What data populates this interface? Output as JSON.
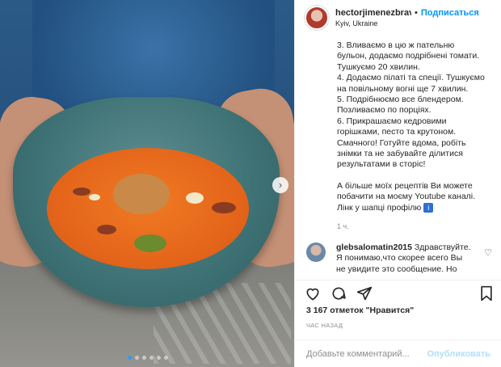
{
  "header": {
    "username": "hectorjimenezbrav",
    "separator": "•",
    "follow_label": "Подписаться",
    "location": "Kyiv, Ukraine"
  },
  "caption": {
    "part1": "3. Вливаємо в цю ж пательню\nбульон, додаємо подрібнені томати.\nТушкуємо 20 хвилин.\n4. Додаємо пілаті та спеції. Тушкуємо\nна повільному вогні ще 7 хвилин.\n5. Подрібнюємо все блендером.\nПозливаємо по порціях.\n6. Прикрашаємо кедровими\nгорішками, песто та крутоном.\nСмачного! Готуйте вдома, робіть\nзнімки та не забувайте ділитися\nрезультатами в сторіс!",
    "part2": "А більше моїх рецептів Ви можете\nпобачити на моєму Youtube каналі.\nЛінк у шапці профілю",
    "time": "1 ч."
  },
  "comment": {
    "username": "glebsalomatin2015",
    "text": "Здравствуйте.\nЯ понимаю,что скорее всего Вы\nне увидите это сообщение. Но"
  },
  "stats": {
    "likes": "3 167 отметок \"Нравится\"",
    "ago": "ЧАС НАЗАД"
  },
  "add_comment": {
    "placeholder": "Добавьте комментарий...",
    "publish": "Опубликовать"
  },
  "icons": {
    "like": "heart-icon",
    "comment": "comment-icon",
    "share": "send-icon",
    "save": "bookmark-icon",
    "next": "chevron-right-icon"
  },
  "colors": {
    "follow": "#0095f6",
    "publish_disabled": "#b2dffc",
    "carousel_active_dot": "#3897f0"
  },
  "carousel": {
    "slides": 6,
    "active_index": 0
  }
}
